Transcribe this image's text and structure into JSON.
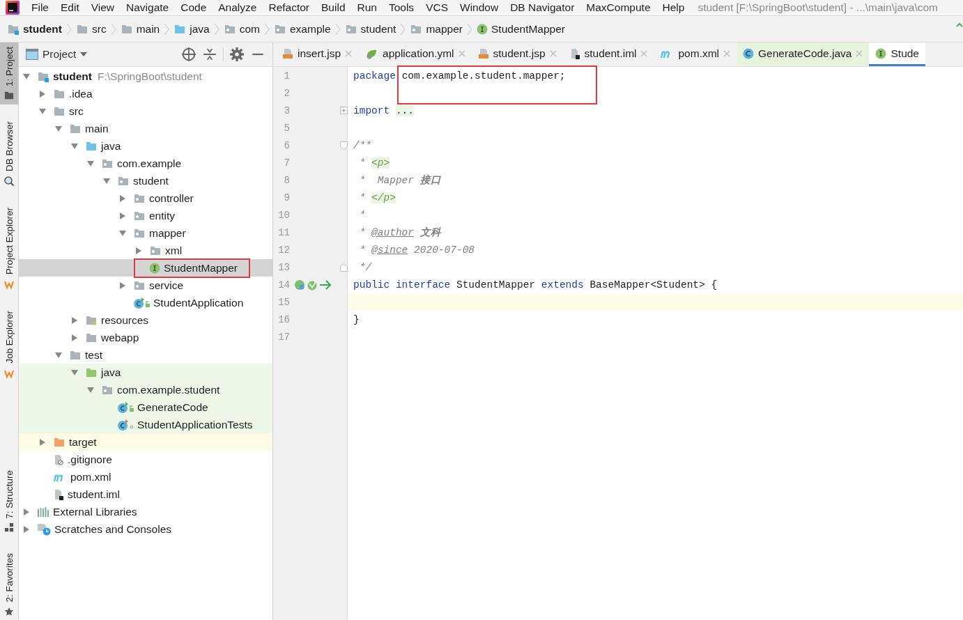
{
  "menu": [
    "File",
    "Edit",
    "View",
    "Navigate",
    "Code",
    "Analyze",
    "Refactor",
    "Build",
    "Run",
    "Tools",
    "VCS",
    "Window",
    "DB Navigator",
    "MaxCompute",
    "Help"
  ],
  "window_title": "student [F:\\SpringBoot\\student] - ...\\main\\java\\com",
  "breadcrumbs": [
    {
      "label": "student",
      "kind": "module"
    },
    {
      "label": "src",
      "kind": "folder"
    },
    {
      "label": "main",
      "kind": "folder"
    },
    {
      "label": "java",
      "kind": "source"
    },
    {
      "label": "com",
      "kind": "package"
    },
    {
      "label": "example",
      "kind": "package"
    },
    {
      "label": "student",
      "kind": "package"
    },
    {
      "label": "mapper",
      "kind": "package"
    },
    {
      "label": "StudentMapper",
      "kind": "interface"
    }
  ],
  "tool_strip": [
    {
      "label": "1: Project",
      "kind": "project",
      "selected": true
    },
    {
      "label": "DB Browser",
      "kind": "db",
      "selected": false
    },
    {
      "label": "Project Explorer",
      "kind": "explorer",
      "selected": false
    },
    {
      "label": "Job Explorer",
      "kind": "explorer",
      "selected": false
    },
    {
      "label": "7: Structure",
      "kind": "structure",
      "selected": false
    },
    {
      "label": "2: Favorites",
      "kind": "favorites",
      "selected": false
    }
  ],
  "project_panel": {
    "title": "Project",
    "tree": [
      {
        "label": "student",
        "hint": "F:\\SpringBoot\\student",
        "kind": "module",
        "expanded": true,
        "selected": false,
        "children": [
          {
            "label": ".idea",
            "kind": "folder",
            "expanded": false,
            "selected": false
          },
          {
            "label": "src",
            "kind": "folder",
            "expanded": true,
            "selected": false,
            "children": [
              {
                "label": "main",
                "kind": "folder",
                "expanded": true,
                "selected": false,
                "children": [
                  {
                    "label": "java",
                    "kind": "source",
                    "expanded": true,
                    "selected": false,
                    "children": [
                      {
                        "label": "com.example",
                        "kind": "package",
                        "expanded": true,
                        "selected": false,
                        "children": [
                          {
                            "label": "student",
                            "kind": "package",
                            "expanded": true,
                            "selected": false,
                            "children": [
                              {
                                "label": "controller",
                                "kind": "package",
                                "expanded": false,
                                "selected": false
                              },
                              {
                                "label": "entity",
                                "kind": "package",
                                "expanded": false,
                                "selected": false
                              },
                              {
                                "label": "mapper",
                                "kind": "package",
                                "expanded": true,
                                "selected": false,
                                "children": [
                                  {
                                    "label": "xml",
                                    "kind": "package",
                                    "expanded": false,
                                    "selected": false
                                  },
                                  {
                                    "label": "StudentMapper",
                                    "kind": "interface",
                                    "selected": true,
                                    "marked": true
                                  }
                                ]
                              },
                              {
                                "label": "service",
                                "kind": "package",
                                "expanded": false,
                                "selected": false
                              },
                              {
                                "label": "StudentApplication",
                                "kind": "app-class",
                                "selected": false
                              }
                            ]
                          }
                        ]
                      }
                    ]
                  },
                  {
                    "label": "resources",
                    "kind": "resources",
                    "expanded": false,
                    "selected": false
                  },
                  {
                    "label": "webapp",
                    "kind": "folder",
                    "expanded": false,
                    "selected": false
                  }
                ]
              },
              {
                "label": "test",
                "kind": "folder",
                "expanded": true,
                "selected": false,
                "children": [
                  {
                    "label": "java",
                    "kind": "test-source",
                    "expanded": true,
                    "selected": false,
                    "test_scope": true,
                    "children": [
                      {
                        "label": "com.example.student",
                        "kind": "package",
                        "expanded": true,
                        "selected": false,
                        "test_scope": true,
                        "children": [
                          {
                            "label": "GenerateCode",
                            "kind": "app-class",
                            "selected": false,
                            "test_scope": true
                          },
                          {
                            "label": "StudentApplicationTests",
                            "kind": "test-class",
                            "selected": false,
                            "test_scope": true
                          }
                        ]
                      }
                    ]
                  }
                ]
              }
            ]
          },
          {
            "label": "target",
            "kind": "excluded",
            "expanded": false,
            "selected": false,
            "excluded": true
          },
          {
            "label": ".gitignore",
            "kind": "ignore-file",
            "selected": false
          },
          {
            "label": "pom.xml",
            "kind": "maven",
            "selected": false
          },
          {
            "label": "student.iml",
            "kind": "iml",
            "selected": false
          }
        ]
      },
      {
        "label": "External Libraries",
        "kind": "libraries",
        "expanded": false,
        "selected": false
      },
      {
        "label": "Scratches and Consoles",
        "kind": "scratches",
        "expanded": false,
        "selected": false
      }
    ]
  },
  "tabs": [
    {
      "label": "insert.jsp",
      "kind": "jsp",
      "selected": false,
      "closable": true
    },
    {
      "label": "application.yml",
      "kind": "yml",
      "selected": false,
      "closable": true
    },
    {
      "label": "student.jsp",
      "kind": "jsp",
      "selected": false,
      "closable": true
    },
    {
      "label": "student.iml",
      "kind": "iml",
      "selected": false,
      "closable": true
    },
    {
      "label": "pom.xml",
      "kind": "maven",
      "selected": false,
      "closable": true
    },
    {
      "label": "GenerateCode.java",
      "kind": "class",
      "selected": false,
      "test_scope": true,
      "closable": true
    },
    {
      "label": "Stude",
      "kind": "interface",
      "selected": true,
      "closable": false
    }
  ],
  "editor": {
    "lines": [
      {
        "number": "1",
        "tokens": [
          {
            "text": "package ",
            "kind": "keyword"
          },
          {
            "text": "com.example.student.mapper;",
            "kind": "plain",
            "marked": true
          }
        ]
      },
      {
        "number": "2"
      },
      {
        "number": "3",
        "fold_start": true,
        "collapsed": true,
        "tokens": [
          {
            "text": "import ",
            "kind": "keyword"
          },
          {
            "text": "...",
            "kind": "folded"
          }
        ]
      },
      {
        "number": "5"
      },
      {
        "number": "6",
        "fold_start": true,
        "collapsed": false,
        "tokens": [
          {
            "text": "/**",
            "kind": "comment"
          }
        ]
      },
      {
        "number": "7",
        "tokens": [
          {
            "text": " * ",
            "kind": "comment"
          },
          {
            "text": "<p>",
            "kind": "tag"
          }
        ]
      },
      {
        "number": "8",
        "tokens": [
          {
            "text": " *  Mapper ",
            "kind": "comment"
          },
          {
            "text": "接口",
            "kind": "comment-bold"
          }
        ]
      },
      {
        "number": "9",
        "tokens": [
          {
            "text": " * ",
            "kind": "comment"
          },
          {
            "text": "</p>",
            "kind": "tag"
          }
        ]
      },
      {
        "number": "10",
        "tokens": [
          {
            "text": " *",
            "kind": "comment"
          }
        ]
      },
      {
        "number": "11",
        "tokens": [
          {
            "text": " * ",
            "kind": "comment"
          },
          {
            "text": "@author",
            "kind": "doctag"
          },
          {
            "text": " 文科",
            "kind": "comment-bold"
          }
        ]
      },
      {
        "number": "12",
        "tokens": [
          {
            "text": " * ",
            "kind": "comment"
          },
          {
            "text": "@since",
            "kind": "doctag"
          },
          {
            "text": " 2020-07-08",
            "kind": "comment"
          }
        ]
      },
      {
        "number": "13",
        "fold_end": true,
        "tokens": [
          {
            "text": " */",
            "kind": "comment"
          }
        ]
      },
      {
        "number": "14",
        "gutter": [
          {
            "kind": "implemented"
          },
          {
            "kind": "mapper"
          },
          {
            "kind": "navigate"
          }
        ],
        "tokens": [
          {
            "text": "public ",
            "kind": "keyword"
          },
          {
            "text": "interface",
            "kind": "keyword"
          },
          {
            "text": " StudentMapper ",
            "kind": "plain"
          },
          {
            "text": "extends",
            "kind": "keyword"
          },
          {
            "text": " BaseMapper<Student> {",
            "kind": "plain"
          }
        ]
      },
      {
        "number": "15",
        "current": true
      },
      {
        "number": "16",
        "tokens": [
          {
            "text": "}",
            "kind": "plain"
          }
        ]
      },
      {
        "number": "17"
      }
    ]
  }
}
